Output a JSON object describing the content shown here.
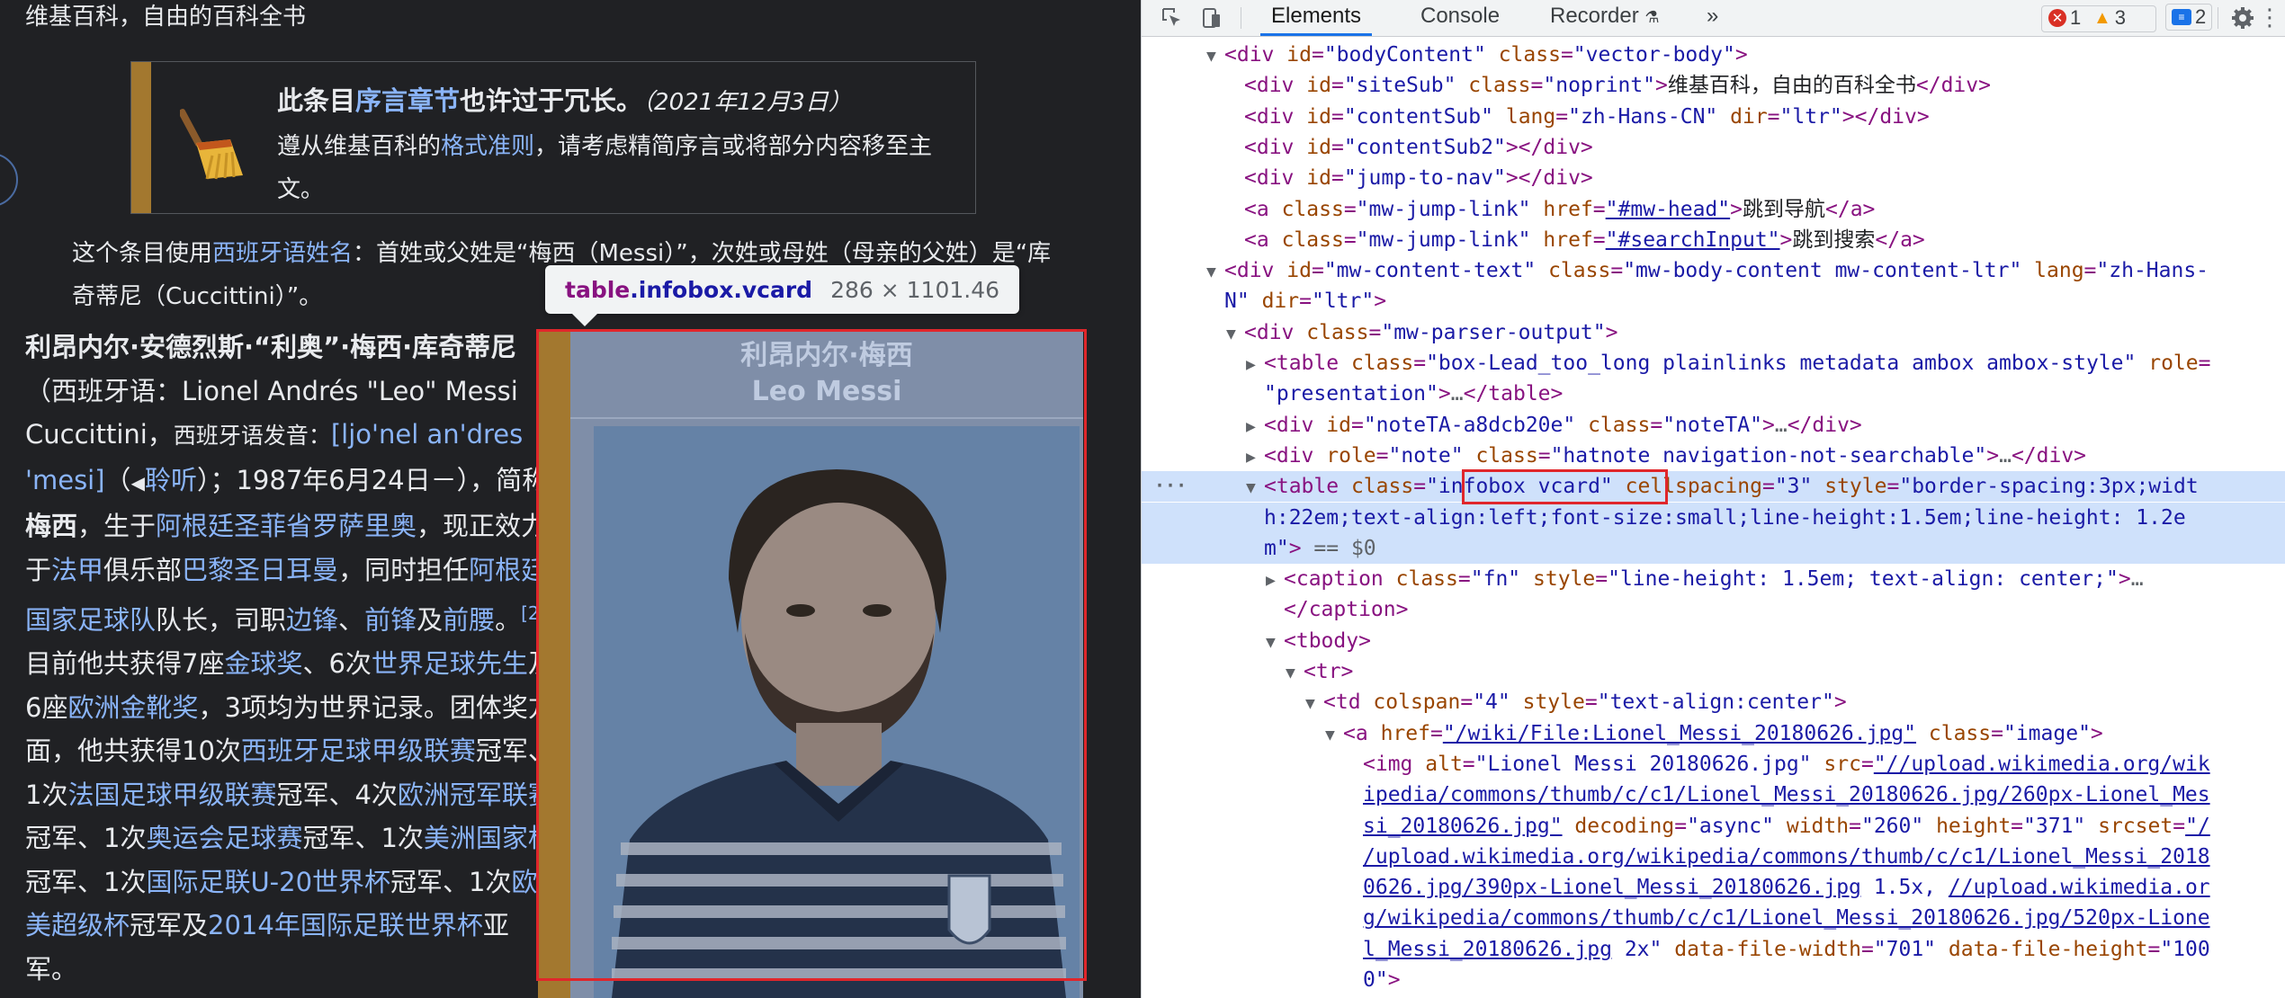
{
  "page": {
    "site_sub": "维基百科，自由的百科全书",
    "ambox": {
      "title_prefix": "此条目",
      "title_link": "序言章节",
      "title_suffix": "也许过于冗长。",
      "date": "（2021年12月3日）",
      "body_prefix": "遵从维基百科的",
      "body_link": "格式准则",
      "body_suffix": "，请考虑精简序言或将部分内容移至主文。"
    },
    "note": {
      "prefix": "这个条目使用",
      "link": "西班牙语姓名",
      "suffix": "：首姓或父姓是“梅西（Messi）”，次姓或母姓（母亲的父姓）是“库奇蒂尼（Cuccittini）”。"
    },
    "lead": {
      "name_bold": "利昂内尔·安德烈斯·“利奥”·梅西·库奇蒂尼",
      "p1": "（西班牙语：Lionel Andrés \"Leo\" Messi Cuccittini，",
      "p1b": "西班牙语发音：",
      "ipa": "[ljo'nel an'dres 'mesi]",
      "listen_pre": "（",
      "listen": "聆听",
      "p2": "）；1987年6月24日－），简称",
      "short_bold": "梅西",
      "p3": "，生于",
      "l1": "阿根廷圣菲省罗萨里奥",
      "p4": "，现正效力于",
      "l2": "法甲",
      "p5": "俱乐部",
      "l3": "巴黎圣日耳曼",
      "p6": "，同时担任",
      "l4": "阿根廷国家足球队",
      "p7": "队长，司职",
      "l5": "边锋",
      "p8": "、",
      "l6": "前锋",
      "p9": "及",
      "l7": "前腰",
      "p10": "。",
      "ref": "[2]",
      "p11": "目前他共获得7座",
      "l8": "金球奖",
      "p12": "、6次",
      "l9": "世界足球先生",
      "p13": "及6座",
      "l10": "欧洲金靴奖",
      "p14": "，3项均为世界记录。团体奖方面，他共获得10次",
      "l11": "西班牙足球甲级联赛",
      "p15": "冠军、1次",
      "l12": "法国足球甲级联赛",
      "p16": "冠军、4次",
      "l13": "欧洲冠军联赛",
      "p17": "冠军、1次",
      "l14": "奥运会足球赛",
      "p18": "冠军、1次",
      "l15": "美洲国家杯",
      "p19": "冠军、1次",
      "l16": "国际足联U-20世界杯",
      "p20": "冠军、1次",
      "l17": "欧美超级杯",
      "p21": "冠军及",
      "l18": "2014年国际足联世界杯",
      "p22": "亚军。"
    },
    "infobox": {
      "caption_zh": "利昂内尔·梅西",
      "caption_en": "Leo Messi"
    },
    "tooltip": {
      "tag": "table",
      "cls": ".infobox.vcard",
      "size": "286 × 1101.46"
    }
  },
  "devtools": {
    "tabs": [
      "Elements",
      "Console",
      "Recorder",
      "»"
    ],
    "active_tab": "Elements",
    "errors": "1",
    "warnings": "3",
    "issues": "2",
    "lines": [
      {
        "indent": 2,
        "tri": "▼",
        "html": "<span class='t'>&lt;div</span> <span class='a'>id</span><span class='t'>=</span><span class='v'>\"bodyContent\"</span> <span class='a'>class</span><span class='t'>=</span><span class='v'>\"vector-body\"</span><span class='t'>&gt;</span>"
      },
      {
        "indent": 3,
        "tri": "",
        "html": "<span class='t'>&lt;div</span> <span class='a'>id</span><span class='t'>=</span><span class='v'>\"siteSub\"</span> <span class='a'>class</span><span class='t'>=</span><span class='v'>\"noprint\"</span><span class='t'>&gt;</span><span class='txt'>维基百科，自由的百科全书</span><span class='t'>&lt;/div&gt;</span>"
      },
      {
        "indent": 3,
        "tri": "",
        "html": "<span class='t'>&lt;div</span> <span class='a'>id</span><span class='t'>=</span><span class='v'>\"contentSub\"</span> <span class='a'>lang</span><span class='t'>=</span><span class='v'>\"zh-Hans-CN\"</span> <span class='a'>dir</span><span class='t'>=</span><span class='v'>\"ltr\"</span><span class='t'>&gt;&lt;/div&gt;</span>"
      },
      {
        "indent": 3,
        "tri": "",
        "html": "<span class='t'>&lt;div</span> <span class='a'>id</span><span class='t'>=</span><span class='v'>\"contentSub2\"</span><span class='t'>&gt;&lt;/div&gt;</span>"
      },
      {
        "indent": 3,
        "tri": "",
        "html": "<span class='t'>&lt;div</span> <span class='a'>id</span><span class='t'>=</span><span class='v'>\"jump-to-nav\"</span><span class='t'>&gt;&lt;/div&gt;</span>"
      },
      {
        "indent": 3,
        "tri": "",
        "html": "<span class='t'>&lt;a</span> <span class='a'>class</span><span class='t'>=</span><span class='v'>\"mw-jump-link\"</span> <span class='a'>href</span><span class='t'>=</span><span class='u'>\"#mw-head\"</span><span class='t'>&gt;</span><span class='txt'>跳到导航</span><span class='t'>&lt;/a&gt;</span>"
      },
      {
        "indent": 3,
        "tri": "",
        "html": "<span class='t'>&lt;a</span> <span class='a'>class</span><span class='t'>=</span><span class='v'>\"mw-jump-link\"</span> <span class='a'>href</span><span class='t'>=</span><span class='u'>\"#searchInput\"</span><span class='t'>&gt;</span><span class='txt'>跳到搜索</span><span class='t'>&lt;/a&gt;</span>"
      },
      {
        "indent": 2,
        "tri": "▼",
        "html": "<span class='t'>&lt;div</span> <span class='a'>id</span><span class='t'>=</span><span class='v'>\"mw-content-text\"</span> <span class='a'>class</span><span class='t'>=</span><span class='v'>\"mw-body-content mw-content-ltr\"</span> <span class='a'>lang</span><span class='t'>=</span><span class='v'>\"zh-Hans-</span>"
      },
      {
        "indent": 2,
        "tri": " ",
        "html": "<span class='v'>N\"</span> <span class='a'>dir</span><span class='t'>=</span><span class='v'>\"ltr\"</span><span class='t'>&gt;</span>"
      },
      {
        "indent": 3,
        "tri": "▼",
        "html": "<span class='t'>&lt;div</span> <span class='a'>class</span><span class='t'>=</span><span class='v'>\"mw-parser-output\"</span><span class='t'>&gt;</span>"
      },
      {
        "indent": 4,
        "tri": "▶",
        "html": "<span class='t'>&lt;table</span> <span class='a'>class</span><span class='t'>=</span><span class='v'>\"box-Lead_too_long plainlinks metadata ambox ambox-style\"</span> <span class='a'>role</span><span class='t'>=</span>"
      },
      {
        "indent": 4,
        "tri": " ",
        "html": "<span class='v'>\"presentation\"</span><span class='t'>&gt;</span><span class='dim'>…</span><span class='t'>&lt;/table&gt;</span>"
      },
      {
        "indent": 4,
        "tri": "▶",
        "html": "<span class='t'>&lt;div</span> <span class='a'>id</span><span class='t'>=</span><span class='v'>\"noteTA-a8dcb20e\"</span> <span class='a'>class</span><span class='t'>=</span><span class='v'>\"noteTA\"</span><span class='t'>&gt;</span><span class='dim'>…</span><span class='t'>&lt;/div&gt;</span>"
      },
      {
        "indent": 4,
        "tri": "▶",
        "html": "<span class='t'>&lt;div</span> <span class='a'>role</span><span class='t'>=</span><span class='v'>\"note\"</span> <span class='a'>class</span><span class='t'>=</span><span class='v'>\"hatnote navigation-not-searchable\"</span><span class='t'>&gt;</span><span class='dim'>…</span><span class='t'>&lt;/div&gt;</span>"
      },
      {
        "indent": 4,
        "tri": "▼",
        "sel": true,
        "html": "<span class='t'>&lt;table</span> <span class='a'>class</span><span class='t'>=</span><span class='v'>\"infobox vcard\"</span> <span class='a'>cellspacing</span><span class='t'>=</span><span class='v'>\"3\"</span> <span class='a'>style</span><span class='t'>=</span><span class='v'>\"border-spacing:3px;widt</span>"
      },
      {
        "indent": 4,
        "tri": " ",
        "sel": true,
        "html": "<span class='v'>h:22em;text-align:left;font-size:small;line-height:1.5em;line-height: 1.2e</span>"
      },
      {
        "indent": 4,
        "tri": " ",
        "sel": true,
        "html": "<span class='v'>m\"</span><span class='t'>&gt;</span> <span class='dim'>== $0</span>"
      },
      {
        "indent": 5,
        "tri": "▶",
        "html": "<span class='t'>&lt;caption</span> <span class='a'>class</span><span class='t'>=</span><span class='v'>\"fn\"</span> <span class='a'>style</span><span class='t'>=</span><span class='v'>\"line-height: 1.5em; text-align: center;\"</span><span class='t'>&gt;</span><span class='dim'>…</span>"
      },
      {
        "indent": 5,
        "tri": " ",
        "html": "<span class='t'>&lt;/caption&gt;</span>"
      },
      {
        "indent": 5,
        "tri": "▼",
        "html": "<span class='t'>&lt;tbody&gt;</span>"
      },
      {
        "indent": 6,
        "tri": "▼",
        "html": "<span class='t'>&lt;tr&gt;</span>"
      },
      {
        "indent": 7,
        "tri": "▼",
        "html": "<span class='t'>&lt;td</span> <span class='a'>colspan</span><span class='t'>=</span><span class='v'>\"4\"</span> <span class='a'>style</span><span class='t'>=</span><span class='v'>\"text-align:center\"</span><span class='t'>&gt;</span>"
      },
      {
        "indent": 8,
        "tri": "▼",
        "html": "<span class='t'>&lt;a</span> <span class='a'>href</span><span class='t'>=</span><span class='u'>\"/wiki/File:Lionel_Messi_20180626.jpg\"</span> <span class='a'>class</span><span class='t'>=</span><span class='v'>\"image\"</span><span class='t'>&gt;</span>"
      },
      {
        "indent": 9,
        "tri": "",
        "html": "<span class='t'>&lt;img</span> <span class='a'>alt</span><span class='t'>=</span><span class='v'>\"Lionel Messi 20180626.jpg\"</span> <span class='a'>src</span><span class='t'>=</span><span class='u'>\"//upload.wikimedia.org/wik</span>"
      },
      {
        "indent": 9,
        "tri": "",
        "html": "<span class='u'>ipedia/commons/thumb/c/c1/Lionel_Messi_20180626.jpg/260px-Lionel_Mes</span>"
      },
      {
        "indent": 9,
        "tri": "",
        "html": "<span class='u'>si_20180626.jpg\"</span> <span class='a'>decoding</span><span class='t'>=</span><span class='v'>\"async\"</span> <span class='a'>width</span><span class='t'>=</span><span class='v'>\"260\"</span> <span class='a'>height</span><span class='t'>=</span><span class='v'>\"371\"</span> <span class='a'>srcset</span><span class='t'>=</span><span class='u'>\"/</span>"
      },
      {
        "indent": 9,
        "tri": "",
        "html": "<span class='u'>/upload.wikimedia.org/wikipedia/commons/thumb/c/c1/Lionel_Messi_2018</span>"
      },
      {
        "indent": 9,
        "tri": "",
        "html": "<span class='u'>0626.jpg/390px-Lionel_Messi_20180626.jpg</span> <span class='v'>1.5x,</span> <span class='u'>//upload.wikimedia.or</span>"
      },
      {
        "indent": 9,
        "tri": "",
        "html": "<span class='u'>g/wikipedia/commons/thumb/c/c1/Lionel_Messi_20180626.jpg/520px-Lione</span>"
      },
      {
        "indent": 9,
        "tri": "",
        "html": "<span class='u'>l_Messi_20180626.jpg</span> <span class='v'>2x\"</span> <span class='a'>data-file-width</span><span class='t'>=</span><span class='v'>\"701\"</span> <span class='a'>data-file-height</span><span class='t'>=</span><span class='v'>\"100</span>"
      },
      {
        "indent": 9,
        "tri": "",
        "html": "<span class='v'>0\"</span><span class='t'>&gt;</span>"
      },
      {
        "indent": 8,
        "tri": "",
        "html": "<span class='t'>&lt;/a&gt;</span>"
      }
    ]
  }
}
